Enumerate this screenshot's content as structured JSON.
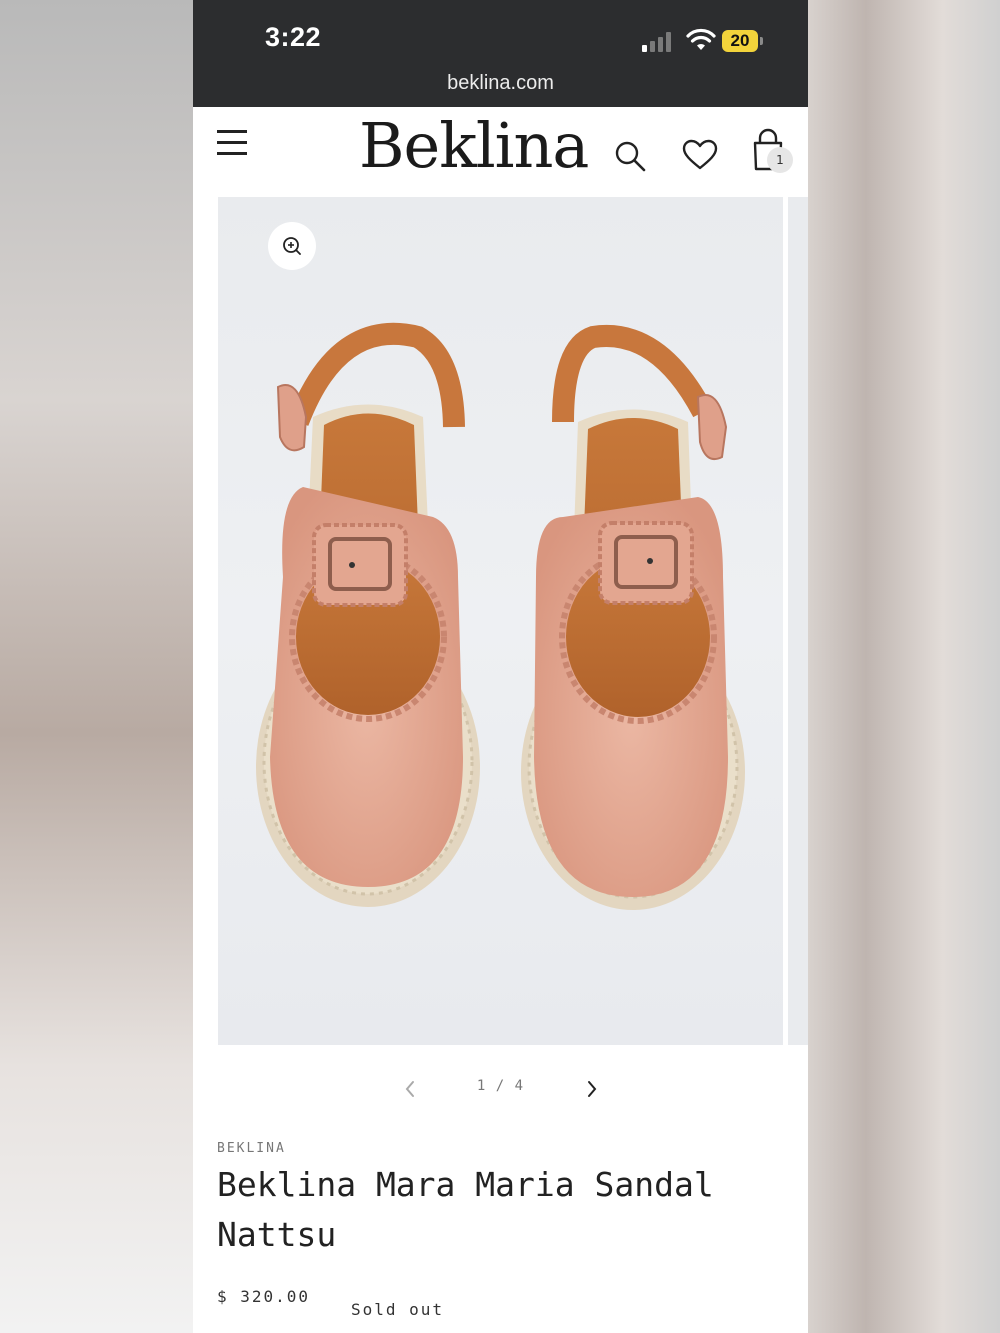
{
  "status_bar": {
    "time": "3:22",
    "battery": "20",
    "url": "beklina.com"
  },
  "header": {
    "logo": "Beklina",
    "menu_icon": "menu-icon",
    "search_icon": "search-icon",
    "wishlist_icon": "heart-icon",
    "cart_icon": "bag-icon",
    "cart_count": "1"
  },
  "gallery": {
    "image": "pink leather slingback sandals with buckles",
    "zoom_icon": "zoom-in-icon",
    "pagination": "1 / 4"
  },
  "product": {
    "vendor": "BEKLINA",
    "title": "Beklina Mara Maria Sandal Nattsu",
    "price": "$ 320.00",
    "availability": "Sold out"
  },
  "colors": {
    "status_bar_bg": "#2c2d2f",
    "battery": "#f2d33b",
    "shoe_leather": "#e2a58f",
    "shoe_sole": "#e6dcc6",
    "photo_bg": "#eceef1"
  }
}
